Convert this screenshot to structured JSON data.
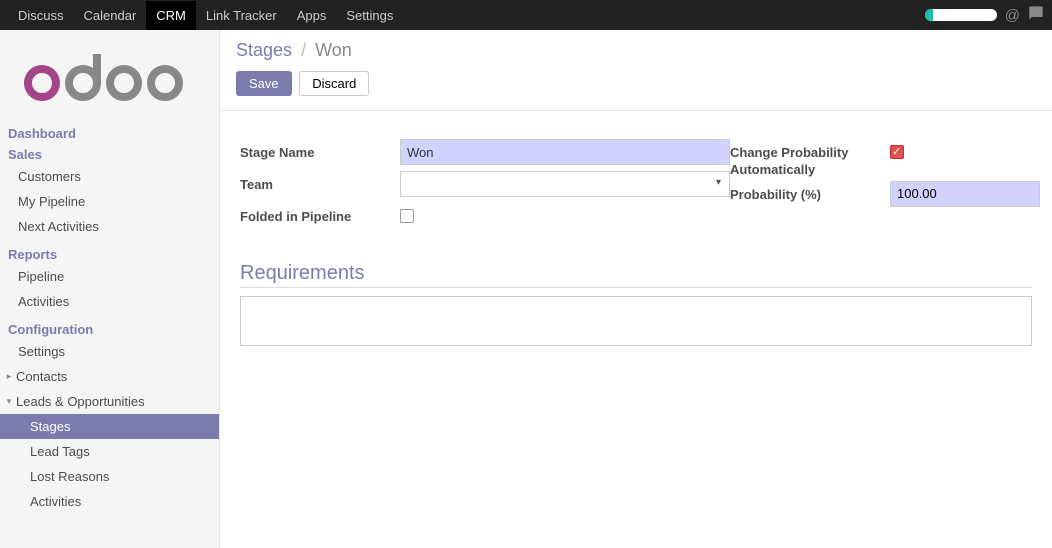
{
  "topnav": {
    "items": [
      {
        "label": "Discuss"
      },
      {
        "label": "Calendar"
      },
      {
        "label": "CRM",
        "active": true
      },
      {
        "label": "Link Tracker"
      },
      {
        "label": "Apps"
      },
      {
        "label": "Settings"
      }
    ]
  },
  "sidebar": {
    "sections": [
      {
        "title": "Dashboard",
        "type": "title"
      },
      {
        "title": "Sales",
        "type": "title"
      },
      {
        "label": "Customers",
        "type": "link"
      },
      {
        "label": "My Pipeline",
        "type": "link"
      },
      {
        "label": "Next Activities",
        "type": "link"
      },
      {
        "title": "Reports",
        "type": "title"
      },
      {
        "label": "Pipeline",
        "type": "link"
      },
      {
        "label": "Activities",
        "type": "link"
      },
      {
        "title": "Configuration",
        "type": "title"
      },
      {
        "label": "Settings",
        "type": "link"
      },
      {
        "label": "Contacts",
        "type": "caret",
        "caret": "▸"
      },
      {
        "label": "Leads & Opportunities",
        "type": "caret",
        "caret": "▾"
      },
      {
        "label": "Stages",
        "type": "sublink",
        "active": true
      },
      {
        "label": "Lead Tags",
        "type": "sublink"
      },
      {
        "label": "Lost Reasons",
        "type": "sublink"
      },
      {
        "label": "Activities",
        "type": "sublink"
      }
    ]
  },
  "breadcrumb": {
    "parent": "Stages",
    "current": "Won"
  },
  "buttons": {
    "save": "Save",
    "discard": "Discard"
  },
  "form": {
    "stage_name_label": "Stage Name",
    "stage_name_value": "Won",
    "team_label": "Team",
    "team_value": "",
    "folded_label": "Folded in Pipeline",
    "folded_checked": false,
    "change_prob_label": "Change Probability Automatically",
    "change_prob_checked": true,
    "probability_label": "Probability (%)",
    "probability_value": "100.00",
    "requirements_title": "Requirements"
  }
}
